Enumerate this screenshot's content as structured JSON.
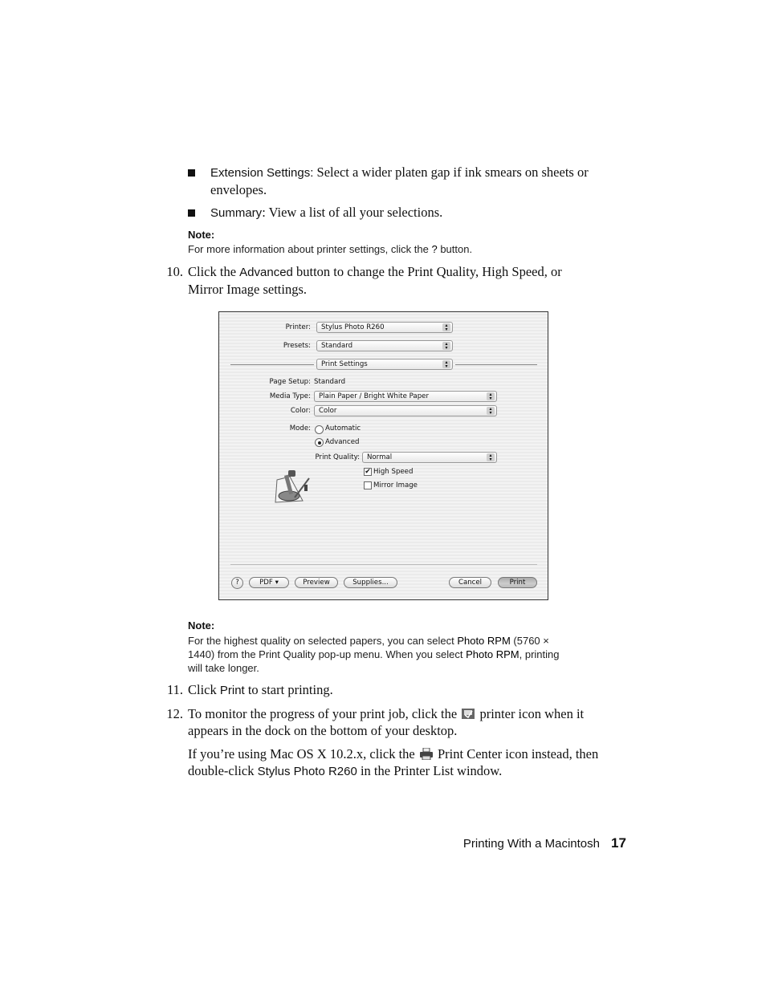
{
  "bullets": [
    {
      "term": "Extension Settings:",
      "text_line1": " Select a wider platen gap if ink smears on sheets or",
      "text_line2": "envelopes."
    },
    {
      "term": "Summary",
      "text": ": View a list of all your selections."
    }
  ],
  "note1": {
    "heading": "Note:",
    "text_before": "For more information about printer settings, click the ",
    "ui": "?",
    "text_after": " button."
  },
  "step10": {
    "number": "10.",
    "t1": "Click the ",
    "ui": "Advanced",
    "t2": " button to change the Print Quality, High Speed, or",
    "line2": "Mirror Image settings."
  },
  "dialog": {
    "printer_label": "Printer:",
    "printer_value": "Stylus Photo R260",
    "presets_label": "Presets:",
    "presets_value": "Standard",
    "panel_value": "Print Settings",
    "page_setup_label": "Page Setup:",
    "page_setup_value": "Standard",
    "media_label": "Media Type:",
    "media_value": "Plain Paper / Bright White Paper",
    "color_label": "Color:",
    "color_value": "Color",
    "mode_label": "Mode:",
    "mode_automatic": "Automatic",
    "mode_advanced": "Advanced",
    "mode_selected": "Advanced",
    "quality_label": "Print Quality:",
    "quality_value": "Normal",
    "high_speed": "High Speed",
    "high_speed_checked": true,
    "mirror_image": "Mirror Image",
    "mirror_image_checked": false,
    "help": "?",
    "pdf": "PDF ▾",
    "preview": "Preview",
    "supplies": "Supplies...",
    "cancel": "Cancel",
    "print": "Print",
    "logo_icon": "epson-printer-icon"
  },
  "note2": {
    "heading": "Note:",
    "l1a": "For the highest quality on selected papers, you can select ",
    "l1ui": "Photo RPM",
    "l1b": " (5760 ×",
    "l2a": "1440) from the Print Quality pop-up menu. When you select ",
    "l2ui": "Photo RPM",
    "l2b": ", printing",
    "l3": "will take longer."
  },
  "step11": {
    "number": "11.",
    "t1": "Click ",
    "ui": "Print",
    "t2": " to start printing."
  },
  "step12": {
    "number": "12.",
    "t1": "To monitor the progress of your print job, click the ",
    "t2": " printer icon when it",
    "line2": "appears in the dock on the bottom of your desktop.",
    "icon": "printer-dock-icon"
  },
  "para": {
    "t1": "If you’re using Mac OS X 10.2.x, click the ",
    "t2": " Print Center icon instead, then",
    "l2a": "double-click ",
    "l2ui": "Stylus Photo R260",
    "l2b": " in the Printer List window.",
    "icon": "print-center-icon"
  },
  "footer": {
    "section": "Printing With a Macintosh",
    "page": "17"
  }
}
